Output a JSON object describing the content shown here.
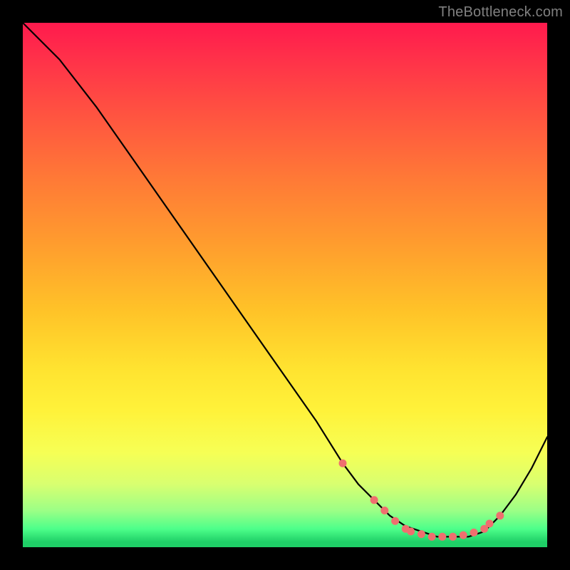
{
  "watermark": "TheBottleneck.com",
  "chart_data": {
    "type": "line",
    "title": "",
    "xlabel": "",
    "ylabel": "",
    "xlim": [
      0,
      100
    ],
    "ylim": [
      0,
      100
    ],
    "background": "rainbow-vertical-gradient",
    "series": [
      {
        "name": "curve",
        "color": "#000000",
        "x": [
          0,
          7,
          14,
          21,
          28,
          35,
          42,
          49,
          56,
          61,
          64,
          67,
          70,
          73,
          76,
          79,
          82,
          85,
          88,
          91,
          94,
          97,
          100
        ],
        "y": [
          100,
          93,
          84,
          74,
          64,
          54,
          44,
          34,
          24,
          16,
          12,
          9,
          6,
          4,
          3,
          2,
          2,
          2,
          3,
          6,
          10,
          15,
          21
        ]
      }
    ],
    "markers": {
      "name": "highlight-points",
      "color": "#ef6f6f",
      "x": [
        61,
        67,
        69,
        71,
        73,
        74,
        76,
        78,
        80,
        82,
        84,
        86,
        88,
        89,
        91
      ],
      "y": [
        16,
        9,
        7,
        5,
        3.5,
        3,
        2.5,
        2,
        2,
        2,
        2.3,
        2.8,
        3.5,
        4.5,
        6
      ]
    }
  }
}
